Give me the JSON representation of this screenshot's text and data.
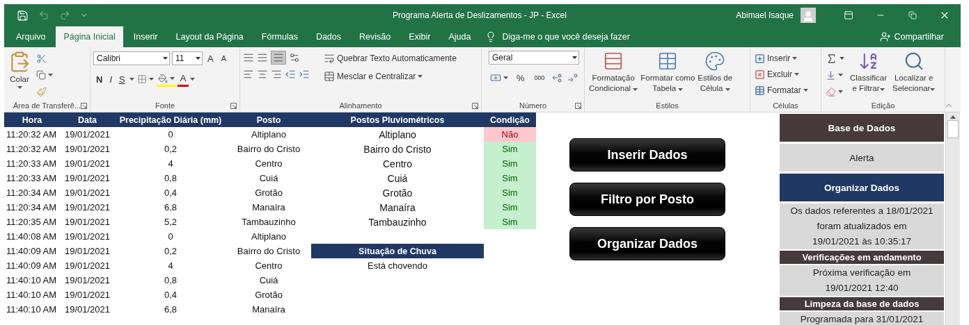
{
  "window": {
    "title": "Programa Alerta de Deslizamentos - JP  -  Excel",
    "user": "Abimael Isaque"
  },
  "ribbon_tabs": [
    {
      "label": "Arquivo",
      "selected": false
    },
    {
      "label": "Página Inicial",
      "selected": true
    },
    {
      "label": "Inserir",
      "selected": false
    },
    {
      "label": "Layout da Página",
      "selected": false
    },
    {
      "label": "Fórmulas",
      "selected": false
    },
    {
      "label": "Dados",
      "selected": false
    },
    {
      "label": "Revisão",
      "selected": false
    },
    {
      "label": "Exibir",
      "selected": false
    },
    {
      "label": "Ajuda",
      "selected": false
    }
  ],
  "tell_me": {
    "placeholder": "Diga-me o que você deseja fazer"
  },
  "share": "Compartilhar",
  "ribbon": {
    "clipboard": {
      "label": "Área de Transferê...",
      "paste": "Colar"
    },
    "font": {
      "label": "Fonte",
      "font": "Calibri",
      "size": "11",
      "grow": "A",
      "shrink": "A",
      "styles": [
        "N",
        "I",
        "S"
      ],
      "font_color_button": "A"
    },
    "alignment": {
      "label": "Alinhamento",
      "wrap": "Quebrar Texto Automaticamente",
      "merge": "Mesclar e Centralizar"
    },
    "number": {
      "label": "Número",
      "format": "Geral",
      "percent": "%",
      "thousands": "000"
    },
    "styles": {
      "label": "Estilos",
      "buttons": [
        {
          "lines": [
            "Formatação",
            "Condicional"
          ]
        },
        {
          "lines": [
            "Formatar como",
            "Tabela"
          ]
        },
        {
          "lines": [
            "Estilos de",
            "Célula"
          ]
        }
      ]
    },
    "cells": {
      "label": "Células",
      "buttons": [
        "Inserir",
        "Excluir",
        "Formatar"
      ]
    },
    "editing": {
      "label": "Edição",
      "buttons": [
        {
          "lines": [
            "Classificar",
            "e Filtrar"
          ]
        },
        {
          "lines": [
            "Localizar e",
            "Selecionar"
          ]
        }
      ]
    }
  },
  "log": {
    "columns": [
      "Hora",
      "Data",
      "Precipitação Diária (mm)",
      "Posto"
    ],
    "rows": [
      {
        "hora": "11:20:32 AM",
        "data": "19/01/2021",
        "mm": "0",
        "posto": "Altiplano"
      },
      {
        "hora": "11:20:32 AM",
        "data": "19/01/2021",
        "mm": "0,2",
        "posto": "Bairro do Cristo"
      },
      {
        "hora": "11:20:33 AM",
        "data": "19/01/2021",
        "mm": "4",
        "posto": "Centro"
      },
      {
        "hora": "11:20:33 AM",
        "data": "19/01/2021",
        "mm": "0,8",
        "posto": "Cuiá"
      },
      {
        "hora": "11:20:34 AM",
        "data": "19/01/2021",
        "mm": "0,4",
        "posto": "Grotão"
      },
      {
        "hora": "11:20:34 AM",
        "data": "19/01/2021",
        "mm": "6,8",
        "posto": "Manaíra"
      },
      {
        "hora": "11:20:35 AM",
        "data": "19/01/2021",
        "mm": "5,2",
        "posto": "Tambauzinho"
      },
      {
        "hora": "11:40:08 AM",
        "data": "19/01/2021",
        "mm": "0",
        "posto": "Altiplano"
      },
      {
        "hora": "11:40:09 AM",
        "data": "19/01/2021",
        "mm": "0,2",
        "posto": "Bairro do Cristo"
      },
      {
        "hora": "11:40:09 AM",
        "data": "19/01/2021",
        "mm": "4",
        "posto": "Centro"
      },
      {
        "hora": "11:40:10 AM",
        "data": "19/01/2021",
        "mm": "0,8",
        "posto": "Cuiá"
      },
      {
        "hora": "11:40:10 AM",
        "data": "19/01/2021",
        "mm": "0,4",
        "posto": "Grotão"
      },
      {
        "hora": "11:40:10 AM",
        "data": "19/01/2021",
        "mm": "6,8",
        "posto": "Manaíra"
      }
    ]
  },
  "stations": {
    "columns": [
      "Postos Pluviométricos",
      "Condição"
    ],
    "rows": [
      {
        "name": "Altiplano",
        "condition": "Não",
        "ok": false
      },
      {
        "name": "Bairro do Cristo",
        "condition": "Sim",
        "ok": true
      },
      {
        "name": "Centro",
        "condition": "Sim",
        "ok": true
      },
      {
        "name": "Cuiá",
        "condition": "Sim",
        "ok": true
      },
      {
        "name": "Grotão",
        "condition": "Sim",
        "ok": true
      },
      {
        "name": "Manaíra",
        "condition": "Sim",
        "ok": true
      },
      {
        "name": "Tambauzinho",
        "condition": "Sim",
        "ok": true
      }
    ]
  },
  "rain": {
    "header": "Situação de Chuva",
    "value": "Está chovendo"
  },
  "macro_buttons": [
    "Inserir Dados",
    "Filtro por Posto",
    "Organizar Dados"
  ],
  "panel": [
    {
      "kind": "dark",
      "lines": [
        "Base de Dados"
      ]
    },
    {
      "kind": "light",
      "lines": [
        "Alerta"
      ]
    },
    {
      "kind": "navy",
      "lines": [
        "Organizar Dados"
      ]
    },
    {
      "kind": "note",
      "lines": [
        "Os dados referentes a 18/01/2021",
        "foram atualizados em",
        "19/01/2021 às 10:35:17"
      ]
    },
    {
      "kind": "heading",
      "lines": [
        "Verificações em andamento"
      ]
    },
    {
      "kind": "note",
      "lines": [
        "Próxima verificação em",
        "19/01/2021 12:40"
      ]
    },
    {
      "kind": "heading",
      "lines": [
        "Limpeza da base de dados"
      ]
    },
    {
      "kind": "note",
      "lines": [
        "Programada para 31/01/2021"
      ]
    }
  ]
}
